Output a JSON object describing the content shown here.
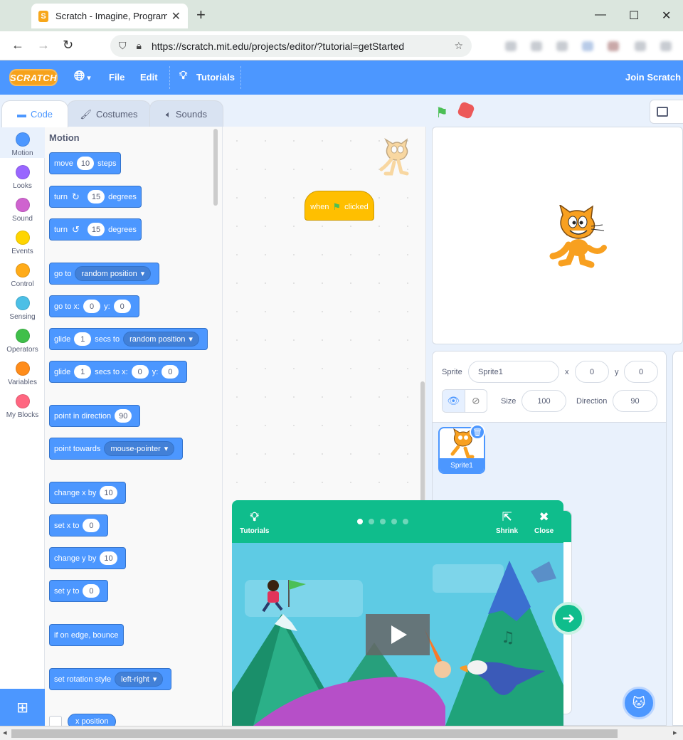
{
  "browser": {
    "tab_title": "Scratch - Imagine, Program, Share",
    "tab_close": "✕",
    "new_tab": "+",
    "url": "https://scratch.mit.edu/projects/editor/?tutorial=getStarted",
    "window_buttons": [
      "—",
      "☐",
      "✕"
    ]
  },
  "menubar": {
    "logo": "SCRATCH",
    "file": "File",
    "edit": "Edit",
    "tutorials": "Tutorials",
    "join": "Join Scratch"
  },
  "tabs": {
    "code": "Code",
    "costumes": "Costumes",
    "sounds": "Sounds"
  },
  "categories": [
    {
      "label": "Motion",
      "color": "#4c97ff"
    },
    {
      "label": "Looks",
      "color": "#9966ff"
    },
    {
      "label": "Sound",
      "color": "#cf63cf"
    },
    {
      "label": "Events",
      "color": "#ffd500"
    },
    {
      "label": "Control",
      "color": "#ffab19"
    },
    {
      "label": "Sensing",
      "color": "#4cbfe6"
    },
    {
      "label": "Operators",
      "color": "#40bf4a"
    },
    {
      "label": "Variables",
      "color": "#ff8c1a"
    },
    {
      "label": "My Blocks",
      "color": "#ff6680"
    }
  ],
  "palette": {
    "title": "Motion",
    "move": {
      "a": "move",
      "v": "10",
      "b": "steps"
    },
    "turn_right": {
      "a": "turn",
      "icon": "↻",
      "v": "15",
      "b": "degrees"
    },
    "turn_left": {
      "a": "turn",
      "icon": "↺",
      "v": "15",
      "b": "degrees"
    },
    "go_to": {
      "a": "go to",
      "dd": "random position"
    },
    "go_to_xy": {
      "a": "go to x:",
      "x": "0",
      "b": "y:",
      "y": "0"
    },
    "glide_to": {
      "a": "glide",
      "v": "1",
      "b": "secs to",
      "dd": "random position"
    },
    "glide_xy": {
      "a": "glide",
      "v": "1",
      "b": "secs to x:",
      "x": "0",
      "c": "y:",
      "y": "0"
    },
    "point_dir": {
      "a": "point in direction",
      "v": "90"
    },
    "point_towards": {
      "a": "point towards",
      "dd": "mouse-pointer"
    },
    "change_x": {
      "a": "change x by",
      "v": "10"
    },
    "set_x": {
      "a": "set x to",
      "v": "0"
    },
    "change_y": {
      "a": "change y by",
      "v": "10"
    },
    "set_y": {
      "a": "set y to",
      "v": "0"
    },
    "bounce": {
      "a": "if on edge, bounce"
    },
    "rotation": {
      "a": "set rotation style",
      "dd": "left-right"
    },
    "x_position": "x position"
  },
  "script": {
    "hat_when": "when",
    "hat_clicked": "clicked"
  },
  "sprite_info": {
    "sprite_label": "Sprite",
    "sprite_name": "Sprite1",
    "x_label": "x",
    "x_value": "0",
    "y_label": "y",
    "y_value": "0",
    "size_label": "Size",
    "size_value": "100",
    "direction_label": "Direction",
    "direction_value": "90",
    "thumb_name": "Sprite1"
  },
  "tutorial": {
    "tutorials_label": "Tutorials",
    "shrink_label": "Shrink",
    "close_label": "Close",
    "pages": 5,
    "current_page": 1
  },
  "colors": {
    "accent": "#4c97ff",
    "tutorial": "#0fbd8c",
    "events": "#ffbf00"
  }
}
